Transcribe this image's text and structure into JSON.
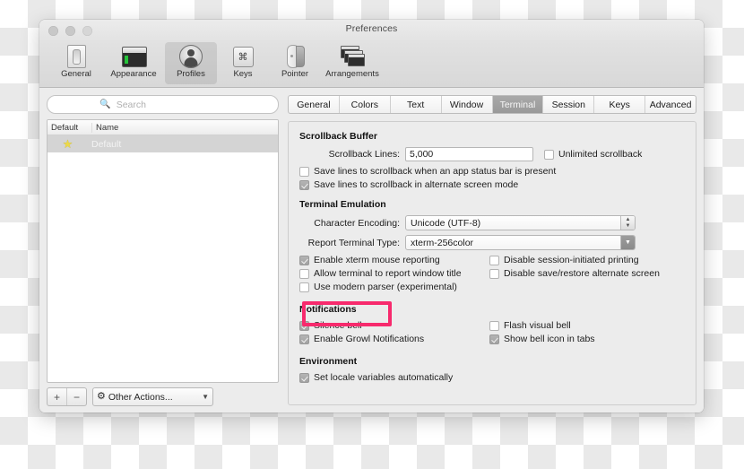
{
  "window": {
    "title": "Preferences"
  },
  "toolbar": {
    "items": [
      {
        "label": "General",
        "icon": "switch-icon"
      },
      {
        "label": "Appearance",
        "icon": "window-green-icon"
      },
      {
        "label": "Profiles",
        "icon": "person-icon"
      },
      {
        "label": "Keys",
        "icon": "command-key-icon"
      },
      {
        "label": "Pointer",
        "icon": "mouse-icon"
      },
      {
        "label": "Arrangements",
        "icon": "stacked-windows-icon"
      }
    ]
  },
  "sidebar": {
    "search": {
      "placeholder": "Search",
      "value": "",
      "icon": "search-icon"
    },
    "columns": [
      "Default",
      "Name"
    ],
    "rows": [
      {
        "star": "★",
        "name": "Default",
        "selected": true
      }
    ],
    "bottom": {
      "add_label": "+",
      "remove_label": "−",
      "other_actions_label": "Other Actions...",
      "gear_icon": "gear-icon",
      "chevron_icon": "chevron-down-icon"
    }
  },
  "tabs": [
    {
      "label": "General",
      "active": false
    },
    {
      "label": "Colors",
      "active": false
    },
    {
      "label": "Text",
      "active": false
    },
    {
      "label": "Window",
      "active": false
    },
    {
      "label": "Terminal",
      "active": true
    },
    {
      "label": "Session",
      "active": false
    },
    {
      "label": "Keys",
      "active": false
    },
    {
      "label": "Advanced",
      "active": false
    }
  ],
  "terminal_tab": {
    "scrollback": {
      "heading": "Scrollback Buffer",
      "lines_label": "Scrollback Lines:",
      "lines_value": "5,000",
      "unlimited_label": "Unlimited scrollback",
      "unlimited_checked": false,
      "save_status_bar_label": "Save lines to scrollback when an app status bar is present",
      "save_status_bar_checked": false,
      "save_alt_screen_label": "Save lines to scrollback in alternate screen mode",
      "save_alt_screen_checked": true
    },
    "emulation": {
      "heading": "Terminal Emulation",
      "encoding_label": "Character Encoding:",
      "encoding_value": "Unicode (UTF-8)",
      "term_type_label": "Report Terminal Type:",
      "term_type_value": "xterm-256color",
      "xterm_mouse_label": "Enable xterm mouse reporting",
      "xterm_mouse_checked": true,
      "report_title_label": "Allow terminal to report window title",
      "report_title_checked": false,
      "modern_parser_label": "Use modern parser (experimental)",
      "modern_parser_checked": false,
      "disable_printing_label": "Disable session-initiated printing",
      "disable_printing_checked": false,
      "disable_alt_screen_label": "Disable save/restore alternate screen",
      "disable_alt_screen_checked": false
    },
    "notifications": {
      "heading": "Notifications",
      "silence_bell_label": "Silence bell",
      "silence_bell_checked": true,
      "growl_label": "Enable Growl Notifications",
      "growl_checked": true,
      "flash_bell_label": "Flash visual bell",
      "flash_bell_checked": false,
      "bell_icon_tabs_label": "Show bell icon in tabs",
      "bell_icon_tabs_checked": true
    },
    "environment": {
      "heading": "Environment",
      "locale_label": "Set locale variables automatically",
      "locale_checked": true
    }
  },
  "annotation": {
    "highlight_color": "#f72a6d",
    "highlight_target": "silence-bell-checkbox"
  }
}
